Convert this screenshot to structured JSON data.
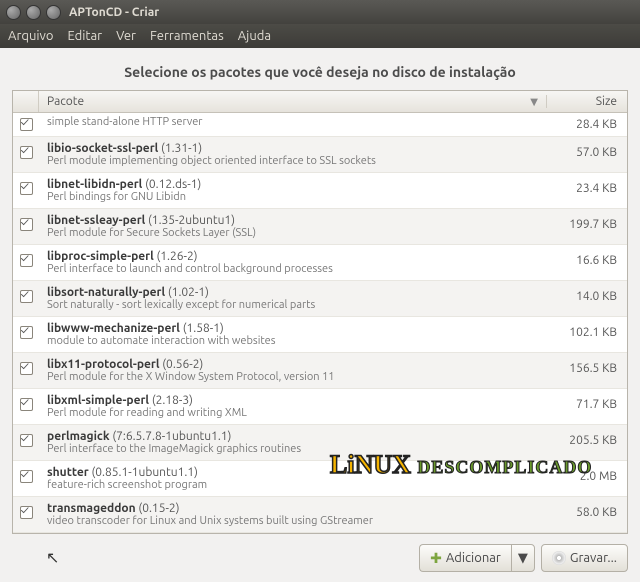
{
  "window": {
    "title": "APTonCD - Criar"
  },
  "menu": {
    "items": [
      "Arquivo",
      "Editar",
      "Ver",
      "Ferramentas",
      "Ajuda"
    ]
  },
  "heading": "Selecione os pacotes que você deseja no disco de instalação",
  "columns": {
    "package": "Pacote",
    "size": "Size"
  },
  "packages": [
    {
      "name": "",
      "version": "",
      "desc": "simple stand-alone HTTP server",
      "size": "28.4 KB",
      "partial": true
    },
    {
      "name": "libio-socket-ssl-perl",
      "version": "(1.31-1)",
      "desc": "Perl module implementing object oriented interface to SSL sockets",
      "size": "57.0 KB"
    },
    {
      "name": "libnet-libidn-perl",
      "version": "(0.12.ds-1)",
      "desc": "Perl bindings for GNU Libidn",
      "size": "23.4 KB"
    },
    {
      "name": "libnet-ssleay-perl",
      "version": "(1.35-2ubuntu1)",
      "desc": "Perl module for Secure Sockets Layer (SSL)",
      "size": "199.7 KB"
    },
    {
      "name": "libproc-simple-perl",
      "version": "(1.26-2)",
      "desc": "Perl interface to launch and control background processes",
      "size": "16.6 KB"
    },
    {
      "name": "libsort-naturally-perl",
      "version": "(1.02-1)",
      "desc": "Sort naturally - sort lexically except for numerical parts",
      "size": "14.0 KB"
    },
    {
      "name": "libwww-mechanize-perl",
      "version": "(1.58-1)",
      "desc": "module to automate interaction with websites",
      "size": "102.1 KB"
    },
    {
      "name": "libx11-protocol-perl",
      "version": "(0.56-2)",
      "desc": "Perl module for the X Window System Protocol, version 11",
      "size": "156.5 KB"
    },
    {
      "name": "libxml-simple-perl",
      "version": "(2.18-3)",
      "desc": "Perl module for reading and writing XML",
      "size": "71.7 KB"
    },
    {
      "name": "perlmagick",
      "version": "(7:6.5.7.8-1ubuntu1.1)",
      "desc": "Perl interface to the ImageMagick graphics routines",
      "size": "205.5 KB"
    },
    {
      "name": "shutter",
      "version": "(0.85.1-1ubuntu1.1)",
      "desc": "feature-rich screenshot program",
      "size": "2.0 MB"
    },
    {
      "name": "transmageddon",
      "version": "(0.15-2)",
      "desc": "video transcoder for Linux and Unix systems built using GStreamer",
      "size": "58.0 KB"
    }
  ],
  "buttons": {
    "add": "Adicionar",
    "burn": "Gravar..."
  },
  "watermark": {
    "a": "LiNUX",
    "b": "DESCOMPLICADO"
  }
}
